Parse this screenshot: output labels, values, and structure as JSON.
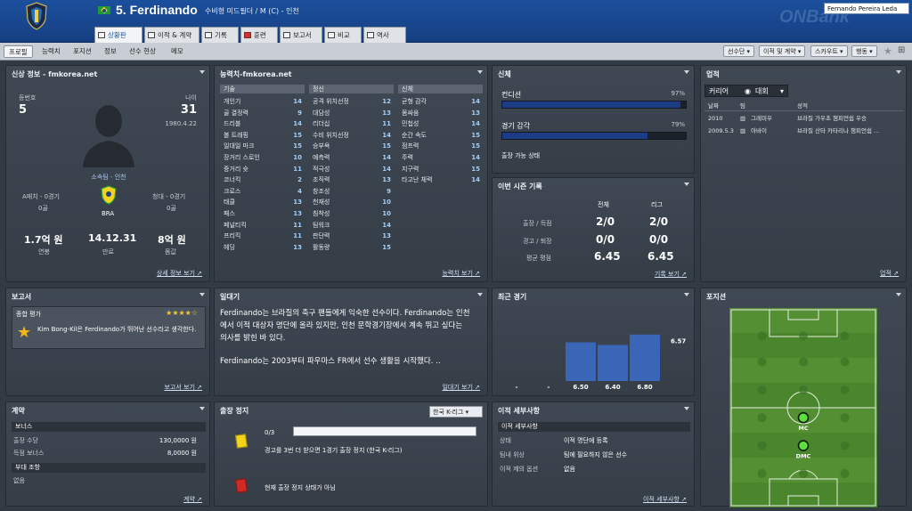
{
  "header": {
    "number_name": "5. Ferdinando",
    "subtitle": "수비형 미드필더 / M (C) - 인천",
    "manager_name": "Fernando Pereira Leda",
    "watermark": "ONBank"
  },
  "tabs": [
    {
      "label": "상황판"
    },
    {
      "label": "이적 & 계약"
    },
    {
      "label": "기록"
    },
    {
      "label": "훈련"
    },
    {
      "label": "보고서"
    },
    {
      "label": "비교"
    },
    {
      "label": "역사"
    }
  ],
  "subnav": {
    "items": [
      "프로필",
      "능력치",
      "포지션",
      "정보",
      "선수 현상",
      "메모"
    ],
    "dropdowns": [
      "선수단",
      "이적 및 계약",
      "스카우트",
      "행동"
    ]
  },
  "personal": {
    "title": "신상 정보 - fmkorea.net",
    "number_label": "등번호",
    "number": "5",
    "age_label": "나이",
    "age": "31",
    "dob": "1980.4.22",
    "club_text": "소속팀 - 인천",
    "a_caps_label": "A매치 - 0경기",
    "a_goals": "0골",
    "youth_caps_label": "청대 - 0경기",
    "youth_goals": "0골",
    "nation": "BRA",
    "wage": "1.7억 원",
    "wage_label": "연봉",
    "expiry": "14.12.31",
    "expiry_label": "만료",
    "value": "8억 원",
    "value_label": "몸값",
    "link": "상세 정보 보기"
  },
  "attributes": {
    "title": "능력치-fmkorea.net",
    "technical_head": "기술",
    "mental_head": "정신",
    "physical_head": "신체",
    "technical": [
      {
        "name": "개인기",
        "value": "14"
      },
      {
        "name": "골 결정력",
        "value": "9"
      },
      {
        "name": "드리블",
        "value": "14"
      },
      {
        "name": "볼 트래핑",
        "value": "15"
      },
      {
        "name": "일대일 마크",
        "value": "15"
      },
      {
        "name": "장거리 스로인",
        "value": "10"
      },
      {
        "name": "중거리 슛",
        "value": "11"
      },
      {
        "name": "코너킥",
        "value": "2"
      },
      {
        "name": "크로스",
        "value": "4"
      },
      {
        "name": "태클",
        "value": "13"
      },
      {
        "name": "패스",
        "value": "13"
      },
      {
        "name": "페널티킥",
        "value": "11"
      },
      {
        "name": "프리킥",
        "value": "11"
      },
      {
        "name": "헤딩",
        "value": "13"
      }
    ],
    "mental": [
      {
        "name": "공격 위치선정",
        "value": "12"
      },
      {
        "name": "대담성",
        "value": "13"
      },
      {
        "name": "리더십",
        "value": "11"
      },
      {
        "name": "수비 위치선정",
        "value": "14"
      },
      {
        "name": "승부욕",
        "value": "15"
      },
      {
        "name": "예측력",
        "value": "14"
      },
      {
        "name": "적극성",
        "value": "14"
      },
      {
        "name": "조직력",
        "value": "13"
      },
      {
        "name": "창조성",
        "value": "9"
      },
      {
        "name": "천재성",
        "value": "10"
      },
      {
        "name": "침착성",
        "value": "10"
      },
      {
        "name": "팀워크",
        "value": "14"
      },
      {
        "name": "판단력",
        "value": "13"
      },
      {
        "name": "활동량",
        "value": "15"
      }
    ],
    "physical": [
      {
        "name": "균형 감각",
        "value": "14"
      },
      {
        "name": "몸싸움",
        "value": "13"
      },
      {
        "name": "민첩성",
        "value": "14"
      },
      {
        "name": "순간 속도",
        "value": "15"
      },
      {
        "name": "점프력",
        "value": "15"
      },
      {
        "name": "주력",
        "value": "14"
      },
      {
        "name": "지구력",
        "value": "15"
      },
      {
        "name": "타고난 체력",
        "value": "14"
      }
    ],
    "link": "능력치 보기"
  },
  "physical_panel": {
    "title": "신체",
    "condition_label": "컨디션",
    "condition_value": "97%",
    "condition_fraction": 0.97,
    "sharpness_label": "경기 감각",
    "sharpness_value": "79%",
    "sharpness_fraction": 0.79,
    "status": "출장 가능 상태"
  },
  "season": {
    "title": "이번 시즌 기록",
    "col_all": "전체",
    "col_league": "리그",
    "rows": [
      {
        "label": "출장 / 득점",
        "all": "2/0",
        "league": "2/0"
      },
      {
        "label": "경고 / 퇴장",
        "all": "0/0",
        "league": "0/0"
      },
      {
        "label": "평균 평점",
        "all": "6.45",
        "league": "6.45"
      }
    ],
    "link": "기록 보기"
  },
  "career": {
    "title": "업적",
    "dropdown1": "커리어",
    "dropdown2": "대회",
    "col_date": "날짜",
    "col_team": "팀",
    "col_result": "성적",
    "rows": [
      {
        "date": "2010",
        "team": "그레미우",
        "result": "브라질 가우초 챔피언쉽 우승"
      },
      {
        "date": "2009.5.3",
        "team": "아바이",
        "result": "브라질 산타 카타리나 챔피언쉽 ..."
      }
    ],
    "link": "업적"
  },
  "reports": {
    "title": "보고서",
    "overall_label": "종합 평가",
    "stars": "★★★★☆",
    "text": "Kim Bong-Kil은 Ferdinando가 뛰어난 선수라고 생각한다.",
    "link": "보고서 보기"
  },
  "bio": {
    "title": "일대기",
    "p1": "Ferdinando는 브라질의 축구 팬들에게 익숙한 선수이다. Ferdinando는 인천에서 이적 대상자 명단에 올라 있지만, 인천 문학경기장에서 계속 뛰고 싶다는 의사를 밝힌 바 있다.",
    "p2": "Ferdinando는 2003부터 파우마스 FR에서 선수 생활을 시작했다.  ..",
    "link": "일대기 보기"
  },
  "recent": {
    "title": "최근 경기",
    "ratings": [
      "6.50",
      "6.40",
      "6.80"
    ],
    "placeholders": [
      "-",
      "-"
    ],
    "avg_label": "6.57"
  },
  "chart_data": {
    "type": "bar",
    "categories": [
      "-",
      "-",
      "6.50",
      "6.40",
      "6.80"
    ],
    "values": [
      null,
      null,
      6.5,
      6.4,
      6.8
    ],
    "reference_line": 6.57,
    "title": "최근 경기"
  },
  "position": {
    "title": "포지션",
    "players": [
      {
        "label": "MC",
        "fx": 0.5,
        "fy": 0.55
      },
      {
        "label": "DMC",
        "fx": 0.5,
        "fy": 0.69
      }
    ]
  },
  "contract": {
    "title": "계약",
    "bonus_head": "보너스",
    "rows": [
      {
        "label": "출장 수당",
        "value": "130,0000 원"
      },
      {
        "label": "득점 보너스",
        "value": "8,0000 원"
      }
    ],
    "extra_head": "부대 조항",
    "extra_value": "없음",
    "link": "계약"
  },
  "ban": {
    "title": "출장 정지",
    "competition": "한국 K-리그",
    "count": "0/3",
    "yellow_text": "경고를 3번 더 받으면 1경기 출장 정지 (한국 K-리그)",
    "red_text": "현재 출장 정지 상태가 아님"
  },
  "transfer": {
    "title": "이적 세부사항",
    "head": "이적 세부사항",
    "rows": [
      {
        "label": "상태",
        "value": "이적 명단에 등록"
      },
      {
        "label": "팀내 위상",
        "value": "팀에 필요하지 않은 선수"
      },
      {
        "label": "이적 제의 옵션",
        "value": "없음"
      }
    ],
    "link": "이적 세부사항"
  },
  "colors": {
    "accent": "#1b4f9c",
    "bar": "#3a66b7",
    "pitch": "#4e8a2f"
  }
}
